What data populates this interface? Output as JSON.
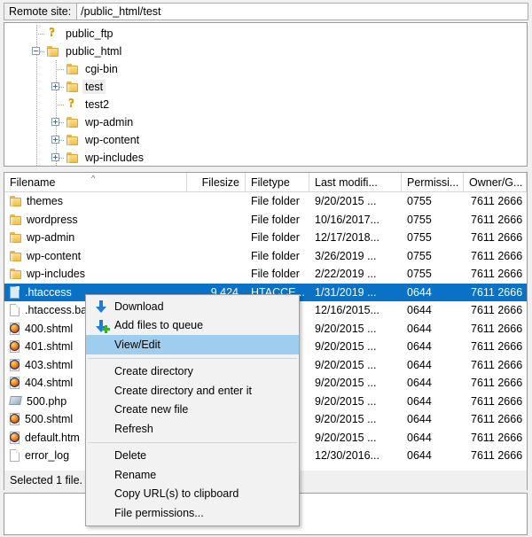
{
  "remote_bar": {
    "label": "Remote site:",
    "path": "/public_html/test"
  },
  "tree": {
    "items": [
      {
        "label": "public_ftp",
        "icon": "unknown-folder-icon",
        "depth": 1,
        "expander": "none",
        "selected": false
      },
      {
        "label": "public_html",
        "icon": "folder-icon",
        "depth": 1,
        "expander": "minus",
        "selected": false
      },
      {
        "label": "cgi-bin",
        "icon": "folder-icon",
        "depth": 2,
        "expander": "none",
        "selected": false
      },
      {
        "label": "test",
        "icon": "folder-icon",
        "depth": 2,
        "expander": "plus",
        "selected": true
      },
      {
        "label": "test2",
        "icon": "unknown-folder-icon",
        "depth": 2,
        "expander": "none",
        "selected": false
      },
      {
        "label": "wp-admin",
        "icon": "folder-icon",
        "depth": 2,
        "expander": "plus",
        "selected": false
      },
      {
        "label": "wp-content",
        "icon": "folder-icon",
        "depth": 2,
        "expander": "plus",
        "selected": false
      },
      {
        "label": "wp-includes",
        "icon": "folder-icon",
        "depth": 2,
        "expander": "plus",
        "selected": false
      }
    ]
  },
  "file_list": {
    "columns": [
      {
        "key": "name",
        "label": "Filename",
        "align": "left"
      },
      {
        "key": "size",
        "label": "Filesize",
        "align": "right"
      },
      {
        "key": "type",
        "label": "Filetype",
        "align": "left"
      },
      {
        "key": "mod",
        "label": "Last modifi...",
        "align": "left"
      },
      {
        "key": "perm",
        "label": "Permissi...",
        "align": "left"
      },
      {
        "key": "own",
        "label": "Owner/G...",
        "align": "left"
      }
    ],
    "sort_indicator": "^",
    "rows": [
      {
        "name": "themes",
        "icon": "folder-icon",
        "size": "",
        "type": "File folder",
        "mod": "9/20/2015 ...",
        "perm": "0755",
        "own": "7611 2666",
        "selected": false
      },
      {
        "name": "wordpress",
        "icon": "folder-icon",
        "size": "",
        "type": "File folder",
        "mod": "10/16/2017...",
        "perm": "0755",
        "own": "7611 2666",
        "selected": false
      },
      {
        "name": "wp-admin",
        "icon": "folder-icon",
        "size": "",
        "type": "File folder",
        "mod": "12/17/2018...",
        "perm": "0755",
        "own": "7611 2666",
        "selected": false
      },
      {
        "name": "wp-content",
        "icon": "folder-icon",
        "size": "",
        "type": "File folder",
        "mod": "3/26/2019 ...",
        "perm": "0755",
        "own": "7611 2666",
        "selected": false
      },
      {
        "name": "wp-includes",
        "icon": "folder-icon",
        "size": "",
        "type": "File folder",
        "mod": "2/22/2019 ...",
        "perm": "0755",
        "own": "7611 2666",
        "selected": false
      },
      {
        "name": ".htaccess",
        "icon": "blue-doc-icon",
        "size": "9,424",
        "type": "HTACCE...",
        "mod": "1/31/2019 ...",
        "perm": "0644",
        "own": "7611 2666",
        "selected": true
      },
      {
        "name": ".htaccess.ba",
        "icon": "doc-icon",
        "size": "",
        "type": "",
        "mod": "12/16/2015...",
        "perm": "0644",
        "own": "7611 2666",
        "selected": false
      },
      {
        "name": "400.shtml",
        "icon": "firefox-icon",
        "size": "",
        "type": "",
        "mod": "9/20/2015 ...",
        "perm": "0644",
        "own": "7611 2666",
        "selected": false
      },
      {
        "name": "401.shtml",
        "icon": "firefox-icon",
        "size": "",
        "type": "",
        "mod": "9/20/2015 ...",
        "perm": "0644",
        "own": "7611 2666",
        "selected": false
      },
      {
        "name": "403.shtml",
        "icon": "firefox-icon",
        "size": "",
        "type": "",
        "mod": "9/20/2015 ...",
        "perm": "0644",
        "own": "7611 2666",
        "selected": false
      },
      {
        "name": "404.shtml",
        "icon": "firefox-icon",
        "size": "",
        "type": "",
        "mod": "9/20/2015 ...",
        "perm": "0644",
        "own": "7611 2666",
        "selected": false
      },
      {
        "name": "500.php",
        "icon": "php-icon",
        "size": "",
        "type": "",
        "mod": "9/20/2015 ...",
        "perm": "0644",
        "own": "7611 2666",
        "selected": false
      },
      {
        "name": "500.shtml",
        "icon": "firefox-icon",
        "size": "",
        "type": "",
        "mod": "9/20/2015 ...",
        "perm": "0644",
        "own": "7611 2666",
        "selected": false
      },
      {
        "name": "default.htm",
        "icon": "firefox-icon",
        "size": "",
        "type": "",
        "mod": "9/20/2015 ...",
        "perm": "0644",
        "own": "7611 2666",
        "selected": false
      },
      {
        "name": "error_log",
        "icon": "doc-icon",
        "size": "",
        "type": "",
        "mod": "12/30/2016...",
        "perm": "0644",
        "own": "7611 2666",
        "selected": false
      }
    ]
  },
  "status_bar": {
    "text": "Selected 1 file."
  },
  "context_menu": {
    "items": [
      {
        "label": "Download",
        "icon": "download-arrow-icon",
        "highlighted": false,
        "separator_after": false
      },
      {
        "label": "Add files to queue",
        "icon": "add-to-queue-arrow-icon",
        "highlighted": false,
        "separator_after": false
      },
      {
        "label": "View/Edit",
        "icon": "none",
        "highlighted": true,
        "separator_after": true
      },
      {
        "label": "Create directory",
        "icon": "none",
        "highlighted": false,
        "separator_after": false
      },
      {
        "label": "Create directory and enter it",
        "icon": "none",
        "highlighted": false,
        "separator_after": false
      },
      {
        "label": "Create new file",
        "icon": "none",
        "highlighted": false,
        "separator_after": false
      },
      {
        "label": "Refresh",
        "icon": "none",
        "highlighted": false,
        "separator_after": true
      },
      {
        "label": "Delete",
        "icon": "none",
        "highlighted": false,
        "separator_after": false
      },
      {
        "label": "Rename",
        "icon": "none",
        "highlighted": false,
        "separator_after": false
      },
      {
        "label": "Copy URL(s) to clipboard",
        "icon": "none",
        "highlighted": false,
        "separator_after": false
      },
      {
        "label": "File permissions...",
        "icon": "none",
        "highlighted": false,
        "separator_after": false
      }
    ]
  },
  "colors": {
    "selection_blue": "#0a72c6",
    "menu_highlight": "#9ecdf0",
    "panel_bg": "#f0f0f0",
    "list_bg": "#ffffff",
    "folder_yellow": "#f6cf69"
  }
}
